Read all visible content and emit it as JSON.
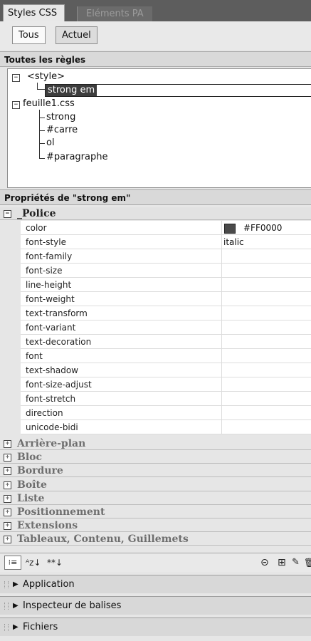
{
  "tabs": [
    {
      "label": "Styles CSS"
    },
    {
      "label": "Eléments PA"
    }
  ],
  "view_buttons": {
    "all": "Tous",
    "current": "Actuel"
  },
  "rules_section": {
    "title": "Toutes les règles",
    "tree": [
      {
        "label": "<style>",
        "expander": "−"
      },
      {
        "label": "strong em"
      },
      {
        "label": "feuille1.css",
        "expander": "−"
      },
      {
        "label": "strong"
      },
      {
        "label": "#carre"
      },
      {
        "label": "ol"
      },
      {
        "label": "#paragraphe"
      }
    ]
  },
  "props_section": {
    "title": "Propriétés de \"strong em\"",
    "police": {
      "label": "_Police",
      "expander": "−",
      "rows": [
        {
          "name": "color",
          "value": "#FF0000"
        },
        {
          "name": "font-style",
          "value": "italic"
        },
        {
          "name": "font-family",
          "value": ""
        },
        {
          "name": "font-size",
          "value": ""
        },
        {
          "name": "line-height",
          "value": ""
        },
        {
          "name": "font-weight",
          "value": ""
        },
        {
          "name": "text-transform",
          "value": ""
        },
        {
          "name": "font-variant",
          "value": ""
        },
        {
          "name": "text-decoration",
          "value": ""
        },
        {
          "name": "font",
          "value": ""
        },
        {
          "name": "text-shadow",
          "value": ""
        },
        {
          "name": "font-size-adjust",
          "value": ""
        },
        {
          "name": "font-stretch",
          "value": ""
        },
        {
          "name": "direction",
          "value": ""
        },
        {
          "name": "unicode-bidi",
          "value": ""
        }
      ]
    },
    "categories": [
      {
        "label": "Arrière-plan",
        "expander": "+"
      },
      {
        "label": "Bloc",
        "expander": "+"
      },
      {
        "label": "Bordure",
        "expander": "+"
      },
      {
        "label": "Boîte",
        "expander": "+"
      },
      {
        "label": "Liste",
        "expander": "+"
      },
      {
        "label": "Positionnement",
        "expander": "+"
      },
      {
        "label": "Extensions",
        "expander": "+"
      },
      {
        "label": "Tableaux, Contenu, Guillemets",
        "expander": "+"
      }
    ]
  },
  "toolbar": {
    "category_view_glyph": "⁝≡",
    "az_glyph": "ᴬz↓",
    "set_props_glyph": "**↓",
    "link_glyph": "⊝",
    "new_rule_glyph": "⊞",
    "edit_glyph": "✎",
    "delete_glyph": "🗑"
  },
  "collapsed_panels": [
    {
      "label": "Application",
      "arrow": "▶"
    },
    {
      "label": "Inspecteur de balises",
      "arrow": "▶"
    },
    {
      "label": "Fichiers",
      "arrow": "▶"
    }
  ],
  "colors": {
    "selection": "#3d3d3d",
    "tab_bar": "#5d5d5d"
  }
}
